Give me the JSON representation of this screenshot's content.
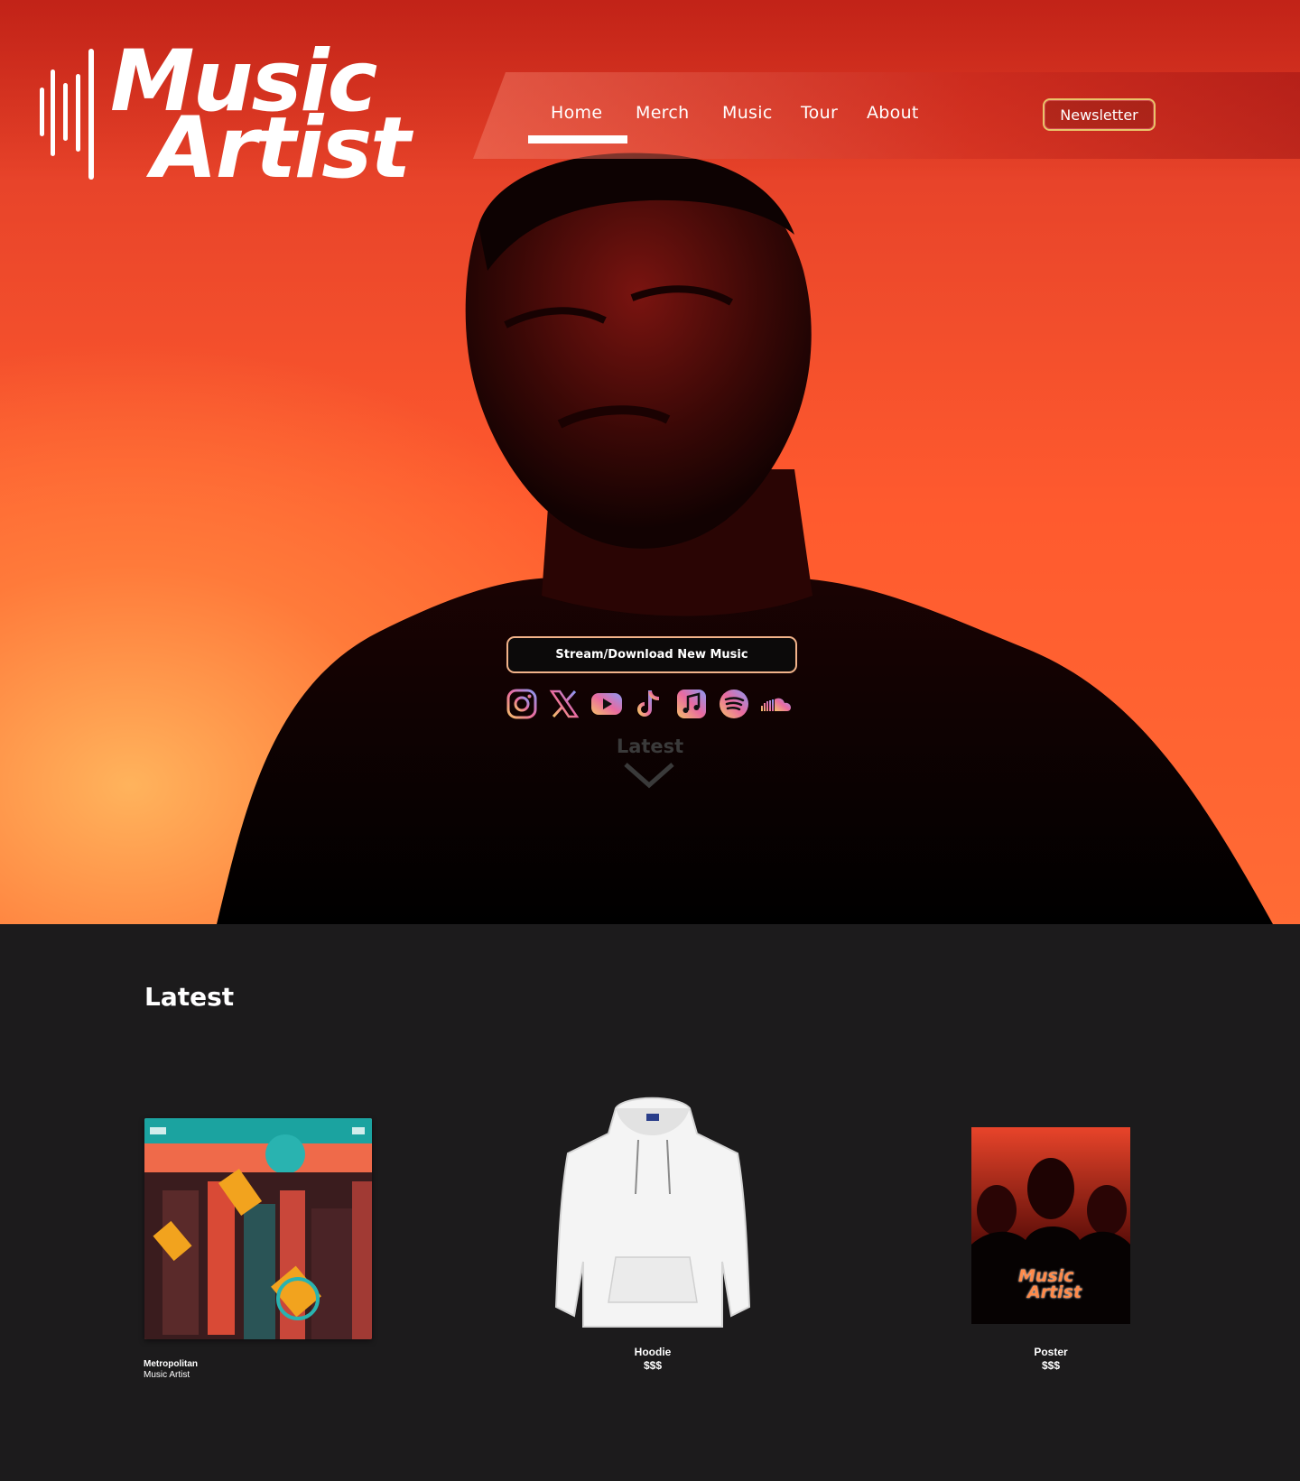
{
  "logo": {
    "line1": "Music",
    "line2": "Artist"
  },
  "nav": {
    "items": [
      "Home",
      "Merch",
      "Music",
      "Tour",
      "About"
    ],
    "active": "Home",
    "newsletter_label": "Newsletter"
  },
  "hero": {
    "stream_label": "Stream/Download New Music",
    "socials": [
      "instagram-icon",
      "x-icon",
      "youtube-icon",
      "tiktok-icon",
      "apple-music-icon",
      "spotify-icon",
      "soundcloud-icon"
    ],
    "scroll_hint": "Latest"
  },
  "latest": {
    "title": "Latest",
    "album": {
      "title": "Metropolitan",
      "artist": "Music Artist"
    },
    "merch": [
      {
        "name": "Hoodie",
        "price": "$$$"
      },
      {
        "name": "Poster",
        "price": "$$$"
      }
    ],
    "poster_logo": {
      "line1": "Music",
      "line2": "Artist"
    }
  },
  "colors": {
    "hero_red": "#e8442a",
    "hero_orange": "#ff6b35",
    "section_bg": "#1c1b1c",
    "accent_gold": "#e9c46a"
  }
}
